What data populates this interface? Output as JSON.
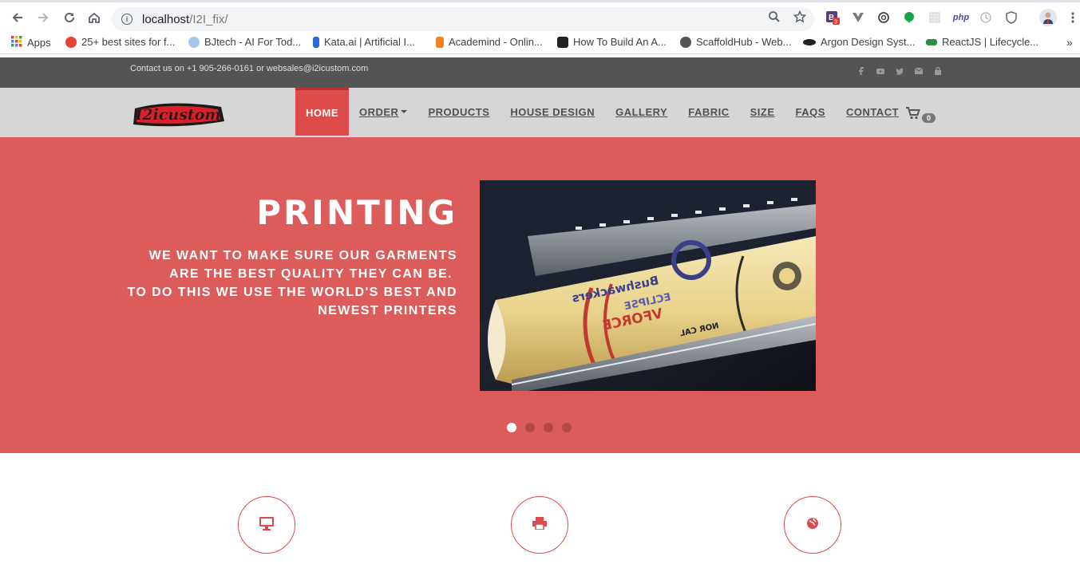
{
  "browser": {
    "url_host": "localhost",
    "url_path": "/I2I_fix/",
    "bookmarks": [
      {
        "label": "Apps",
        "color": "#e94235"
      },
      {
        "label": "25+ best sites for f...",
        "color": "#ea4335"
      },
      {
        "label": "BJtech - AI For Tod...",
        "color": "#6a9bd8"
      },
      {
        "label": "Kata.ai | Artificial I...",
        "color": "#2a6ad8"
      },
      {
        "label": "Academind - Onlin...",
        "color": "#f58220"
      },
      {
        "label": "How To Build An A...",
        "color": "#222222"
      },
      {
        "label": "ScaffoldHub - Web...",
        "color": "#555555"
      },
      {
        "label": "Argon Design Syst...",
        "color": "#222222"
      },
      {
        "label": "ReactJS | Lifecycle...",
        "color": "#2f8d46"
      }
    ],
    "ext_badge": "3",
    "ext_php": "php"
  },
  "site": {
    "contact": "Contact us on +1 905-266-0161 or websales@i2icustom.com",
    "logo_text": "I2icustom",
    "menu": [
      {
        "label": "HOME",
        "active": true
      },
      {
        "label": "ORDER",
        "dropdown": true
      },
      {
        "label": "PRODUCTS"
      },
      {
        "label": "HOUSE DESIGN"
      },
      {
        "label": "GALLERY"
      },
      {
        "label": "FABRIC"
      },
      {
        "label": "SIZE"
      },
      {
        "label": "FAQS"
      },
      {
        "label": "CONTACT"
      }
    ],
    "cart_count": "0",
    "hero": {
      "title": "PRINTING",
      "line1": "WE WANT TO MAKE SURE OUR GARMENTS",
      "line2": "ARE THE BEST QUALITY THEY CAN BE.",
      "line3": "TO DO THIS WE USE THE WORLD'S BEST AND",
      "line4": "NEWEST PRINTERS",
      "slide_count": 4,
      "active_slide": 1
    },
    "print_labels": {
      "brand": "Bushwackers",
      "line1": "ECLIPSE",
      "line2": "VFORCE",
      "line3": "NOR CAL"
    },
    "colors": {
      "accent": "#dc5c5c",
      "active_tab": "#dd4b4b",
      "topbar": "#545454",
      "nav_bg": "#d6d6d6"
    },
    "feature_icons": [
      "desktop-icon",
      "printer-icon",
      "globe-icon"
    ]
  }
}
